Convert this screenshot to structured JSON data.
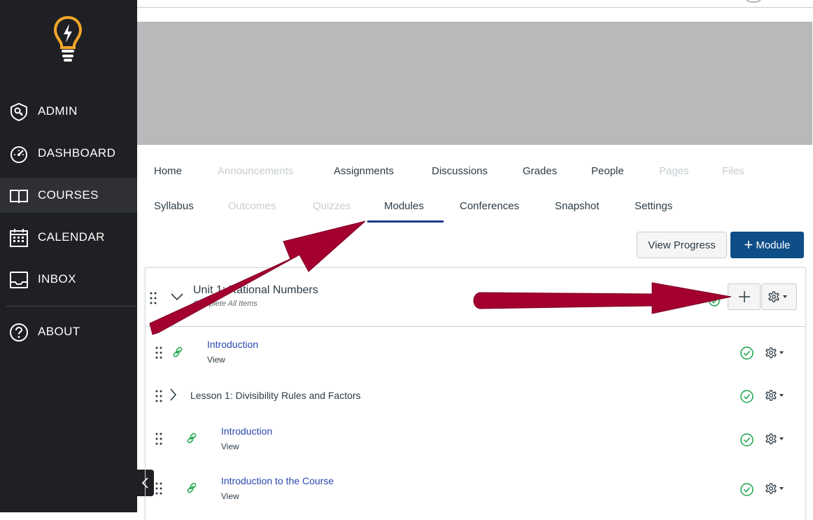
{
  "sidebar": {
    "items": [
      {
        "label": "ADMIN",
        "icon": "shield-icon"
      },
      {
        "label": "DASHBOARD",
        "icon": "speedometer-icon"
      },
      {
        "label": "COURSES",
        "icon": "book-icon"
      },
      {
        "label": "CALENDAR",
        "icon": "calendar-icon"
      },
      {
        "label": "INBOX",
        "icon": "inbox-icon"
      },
      {
        "label": "ABOUT",
        "icon": "help-icon"
      }
    ],
    "active": "COURSES",
    "logo_colors": {
      "bulb": "#f4a62a",
      "bolt": "#ffffff"
    }
  },
  "course_nav": {
    "row1": [
      {
        "label": "Home",
        "enabled": true
      },
      {
        "label": "Announcements",
        "enabled": false
      },
      {
        "label": "Assignments",
        "enabled": true
      },
      {
        "label": "Discussions",
        "enabled": true
      },
      {
        "label": "Grades",
        "enabled": true
      },
      {
        "label": "People",
        "enabled": true
      },
      {
        "label": "Pages",
        "enabled": false
      },
      {
        "label": "Files",
        "enabled": false
      }
    ],
    "row2": [
      {
        "label": "Syllabus",
        "enabled": true
      },
      {
        "label": "Outcomes",
        "enabled": false
      },
      {
        "label": "Quizzes",
        "enabled": false
      },
      {
        "label": "Modules",
        "enabled": true,
        "selected": true
      },
      {
        "label": "Conferences",
        "enabled": true
      },
      {
        "label": "Snapshot",
        "enabled": true
      },
      {
        "label": "Settings",
        "enabled": true
      }
    ]
  },
  "toolbar": {
    "view_progress_label": "View Progress",
    "add_module_label": "Module"
  },
  "module": {
    "title": "Unit 1: Rational Numbers",
    "requirement": "Complete All Items",
    "items": [
      {
        "type": "link",
        "title": "Introduction",
        "subtitle": "View",
        "completed": true
      },
      {
        "type": "subheader",
        "title": "Lesson 1: Divisibility Rules and Factors",
        "completed": true
      },
      {
        "type": "link",
        "title": "Introduction",
        "subtitle": "View",
        "completed": true
      },
      {
        "type": "link",
        "title": "Introduction to the Course",
        "subtitle": "View",
        "completed": true
      }
    ]
  },
  "colors": {
    "sidebar_bg": "#1f2023",
    "primary_button": "#0e4d87",
    "link": "#2b47b0",
    "complete_green": "#1aa54a",
    "annotation_arrow": "#a30030",
    "banner": "#b8b9bb"
  }
}
